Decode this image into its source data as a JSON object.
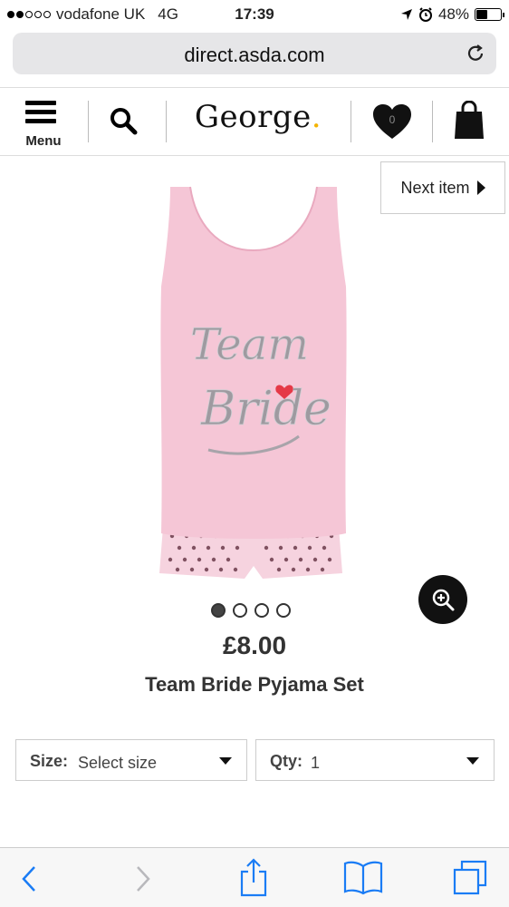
{
  "status_bar": {
    "carrier": "vodafone UK",
    "network": "4G",
    "time": "17:39",
    "battery_percent": "48%",
    "battery_level": 0.48,
    "signal_filled": 2,
    "signal_total": 5
  },
  "browser": {
    "url": "direct.asda.com"
  },
  "header": {
    "menu_label": "Menu",
    "logo_text": "George",
    "logo_dot": ".",
    "wishlist_count": "0"
  },
  "product": {
    "next_item_label": "Next item",
    "price": "£8.00",
    "name": "Team Bride Pyjama Set",
    "image_count": 4,
    "active_image": 1,
    "graphic_text_line1": "Team",
    "graphic_text_line2": "Bride"
  },
  "options": {
    "size_label": "Size:",
    "size_value": "Select size",
    "qty_label": "Qty:",
    "qty_value": "1"
  },
  "colors": {
    "pink": "#f5c9d9",
    "accent": "#f4b400"
  }
}
